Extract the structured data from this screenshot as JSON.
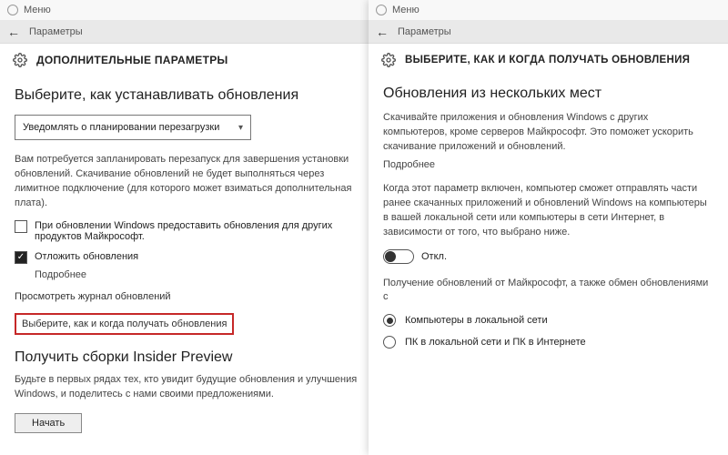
{
  "left": {
    "menu": "Меню",
    "breadcrumb": "Параметры",
    "title": "ДОПОЛНИТЕЛЬНЫЕ ПАРАМЕТРЫ",
    "section_title": "Выберите, как устанавливать обновления",
    "dropdown_value": "Уведомлять о планировании перезагрузки",
    "para1": "Вам потребуется запланировать перезапуск для завершения установки обновлений. Скачивание обновлений не будет выполняться через лимитное подключение (для которого может взиматься дополнительная плата).",
    "cb_other_products": "При обновлении Windows предоставить обновления для других продуктов Майкрософт.",
    "cb_defer": "Отложить обновления",
    "defer_more": "Подробнее",
    "link_history": "Просмотреть журнал обновлений",
    "link_choose": "Выберите, как и когда получать обновления",
    "insider_title": "Получить сборки Insider Preview",
    "insider_text": "Будьте в первых рядах тех, кто увидит будущие обновления и улучшения Windows, и поделитесь с нами своими предложениями.",
    "insider_btn": "Начать"
  },
  "right": {
    "menu": "Меню",
    "breadcrumb": "Параметры",
    "title": "ВЫБЕРИТЕ, КАК И КОГДА ПОЛУЧАТЬ ОБНОВЛЕНИЯ",
    "section_title": "Обновления из нескольких мест",
    "para1": "Скачивайте приложения и обновления Windows с других компьютеров, кроме серверов Майкрософт. Это поможет ускорить скачивание приложений и обновлений.",
    "more": "Подробнее",
    "para2": "Когда этот параметр включен, компьютер сможет отправлять части ранее скачанных приложений и обновлений Windows на компьютеры в вашей локальной сети или компьютеры в сети Интернет, в зависимости от того, что выбрано ниже.",
    "toggle_label": "Откл.",
    "para3": "Получение обновлений от Майкрософт, а также обмен обновлениями с",
    "radio_lan": "Компьютеры в локальной сети",
    "radio_internet": "ПК в локальной сети и ПК в Интернете"
  }
}
